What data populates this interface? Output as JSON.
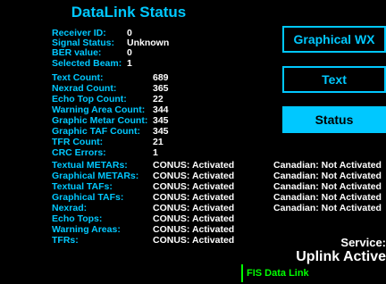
{
  "title": "DataLink Status",
  "header_stats": [
    {
      "label": "Receiver ID:",
      "value": "0"
    },
    {
      "label": "Signal Status:",
      "value": "Unknown"
    },
    {
      "label": "BER value:",
      "value": "0"
    },
    {
      "label": "Selected Beam:",
      "value": "1"
    }
  ],
  "counts": [
    {
      "label": "Text Count:",
      "value": "689"
    },
    {
      "label": "Nexrad Count:",
      "value": "365"
    },
    {
      "label": "Echo Top Count:",
      "value": "22"
    },
    {
      "label": "Warning Area Count:",
      "value": "344"
    },
    {
      "label": "Graphic Metar Count:",
      "value": "345"
    },
    {
      "label": "Graphic TAF Count:",
      "value": "345"
    },
    {
      "label": "TFR Count:",
      "value": "21"
    },
    {
      "label": "CRC Errors:",
      "value": "1"
    }
  ],
  "products": [
    {
      "label": "Textual METARs:",
      "conus": "CONUS: Activated",
      "canadian": "Canadian: Not Activated"
    },
    {
      "label": "Graphical METARs:",
      "conus": "CONUS: Activated",
      "canadian": "Canadian: Not Activated"
    },
    {
      "label": "Textual TAFs:",
      "conus": "CONUS: Activated",
      "canadian": "Canadian: Not Activated"
    },
    {
      "label": "Graphical TAFs:",
      "conus": "CONUS: Activated",
      "canadian": "Canadian: Not Activated"
    },
    {
      "label": "Nexrad:",
      "conus": "CONUS: Activated",
      "canadian": "Canadian: Not Activated"
    },
    {
      "label": "Echo Tops:",
      "conus": "CONUS: Activated",
      "canadian": ""
    },
    {
      "label": "Warning Areas:",
      "conus": "CONUS: Activated",
      "canadian": ""
    },
    {
      "label": "TFRs:",
      "conus": "CONUS: Activated",
      "canadian": ""
    }
  ],
  "buttons": {
    "graphical_wx": "Graphical WX",
    "text": "Text",
    "status": "Status"
  },
  "service": {
    "label": "Service:",
    "value": "Uplink Active"
  },
  "footer": {
    "fis_label": "FIS Data Link"
  },
  "colors": {
    "accent": "#00c8ff",
    "text": "#ffffff",
    "background": "#000000",
    "fis_green": "#00ff00"
  }
}
